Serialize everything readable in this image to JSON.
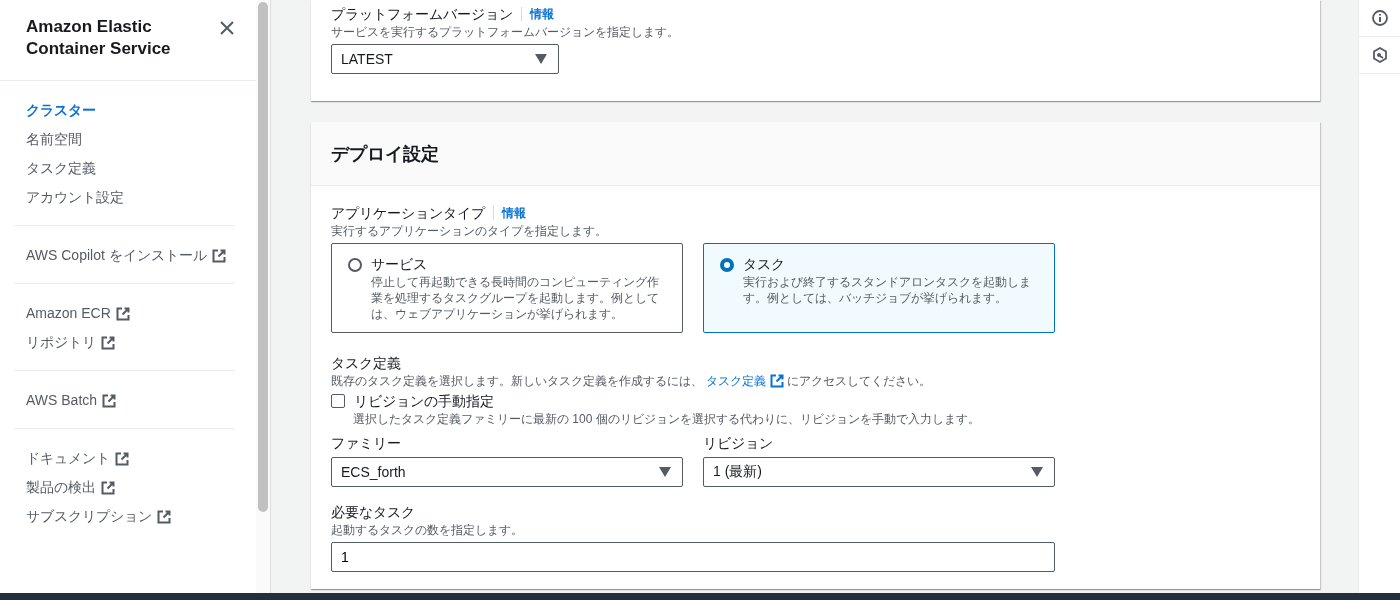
{
  "sidebar": {
    "title": "Amazon Elastic Container Service",
    "groups": [
      [
        {
          "label": "クラスター",
          "selected": true,
          "external": false
        },
        {
          "label": "名前空間",
          "selected": false,
          "external": false
        },
        {
          "label": "タスク定義",
          "selected": false,
          "external": false
        },
        {
          "label": "アカウント設定",
          "selected": false,
          "external": false
        }
      ],
      [
        {
          "label": "AWS Copilot をインストール",
          "selected": false,
          "external": true
        }
      ],
      [
        {
          "label": "Amazon ECR",
          "selected": false,
          "external": true
        },
        {
          "label": "リポジトリ",
          "selected": false,
          "external": true
        }
      ],
      [
        {
          "label": "AWS Batch",
          "selected": false,
          "external": true
        }
      ],
      [
        {
          "label": "ドキュメント",
          "selected": false,
          "external": true
        },
        {
          "label": "製品の検出",
          "selected": false,
          "external": true
        },
        {
          "label": "サブスクリプション",
          "selected": false,
          "external": true
        }
      ]
    ]
  },
  "platform": {
    "label": "プラットフォームバージョン",
    "info": "情報",
    "description": "サービスを実行するプラットフォームバージョンを指定します。",
    "value": "LATEST"
  },
  "deploy": {
    "title": "デプロイ設定",
    "app_type": {
      "label": "アプリケーションタイプ",
      "info": "情報",
      "description": "実行するアプリケーションのタイプを指定します。",
      "options": [
        {
          "title": "サービス",
          "description": "停止して再起動できる長時間のコンピューティング作業を処理するタスクグループを起動します。例としては、ウェブアプリケーションが挙げられます。",
          "selected": false
        },
        {
          "title": "タスク",
          "description": "実行および終了するスタンドアロンタスクを起動します。例としては、バッチジョブが挙げられます。",
          "selected": true
        }
      ]
    },
    "task_def": {
      "label": "タスク定義",
      "description_before": "既存のタスク定義を選択します。新しいタスク定義を作成するには、",
      "link": "タスク定義",
      "description_after": "にアクセスしてください。"
    },
    "manual_revision": {
      "label": "リビジョンの手動指定",
      "checked": false,
      "description": "選択したタスク定義ファミリーに最新の 100 個のリビジョンを選択する代わりに、リビジョンを手動で入力します。"
    },
    "family": {
      "label": "ファミリー",
      "value": "ECS_forth"
    },
    "revision": {
      "label": "リビジョン",
      "value": "1 (最新)"
    },
    "desired": {
      "label": "必要なタスク",
      "description": "起動するタスクの数を指定します。",
      "value": "1"
    }
  }
}
